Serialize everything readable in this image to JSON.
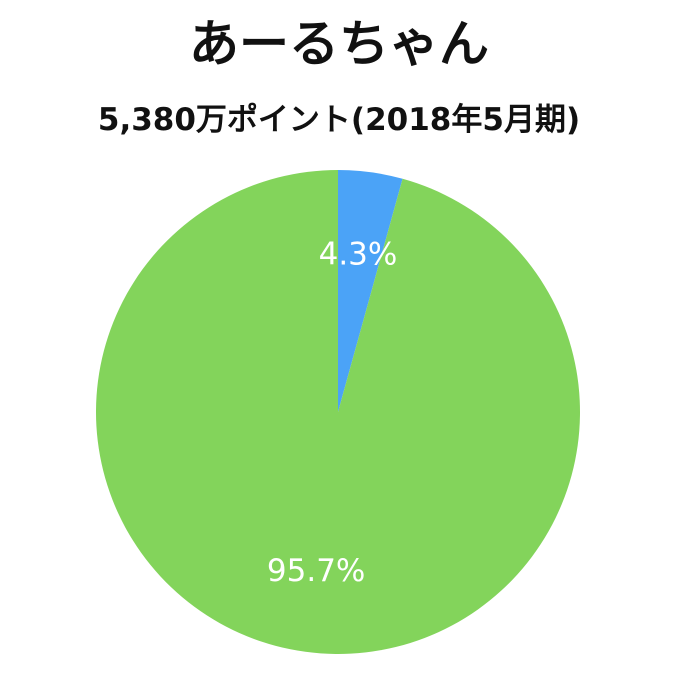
{
  "chart_data": {
    "type": "pie",
    "title": "あーるちゃん",
    "subtitle": "5,380万ポイント(2018年5月期)",
    "slices": [
      {
        "value": 4.3,
        "label": "4.3%",
        "color": "#4ba3f7"
      },
      {
        "value": 95.7,
        "label": "95.7%",
        "color": "#83d45b"
      }
    ],
    "start_angle": "12 o'clock",
    "direction": "clockwise",
    "legend": "none"
  }
}
